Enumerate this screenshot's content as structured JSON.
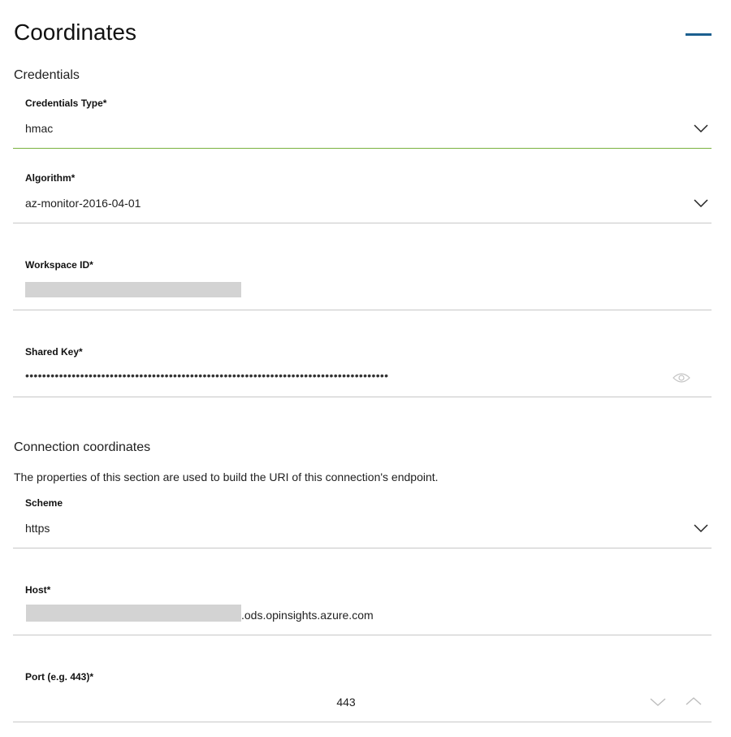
{
  "page": {
    "title": "Coordinates"
  },
  "credentials": {
    "section_title": "Credentials",
    "credentials_type": {
      "label": "Credentials Type*",
      "value": "hmac"
    },
    "algorithm": {
      "label": "Algorithm*",
      "value": "az-monitor-2016-04-01"
    },
    "workspace_id": {
      "label": "Workspace ID*",
      "value": ""
    },
    "shared_key": {
      "label": "Shared Key*",
      "value": "••••••••••••••••••••••••••••••••••••••••••••••••••••••••••••••••••••••••••••••••••••••"
    }
  },
  "connection": {
    "section_title": "Connection coordinates",
    "description": "The properties of this section are used to build the URI of this connection's endpoint.",
    "scheme": {
      "label": "Scheme",
      "value": "https"
    },
    "host": {
      "label": "Host*",
      "value_suffix": ".ods.opinsights.azure.com"
    },
    "port": {
      "label": "Port (e.g. 443)*",
      "value": "443"
    }
  },
  "colors": {
    "accent_active": "#79b23e",
    "collapse_bar": "#1b5f8f",
    "border": "#c7c7c7",
    "redaction": "#d3d3d3"
  },
  "icons": {
    "dropdown": "chevron-down-icon",
    "reveal": "eye-icon",
    "increment": "chevron-up-icon",
    "decrement": "chevron-down-icon"
  }
}
